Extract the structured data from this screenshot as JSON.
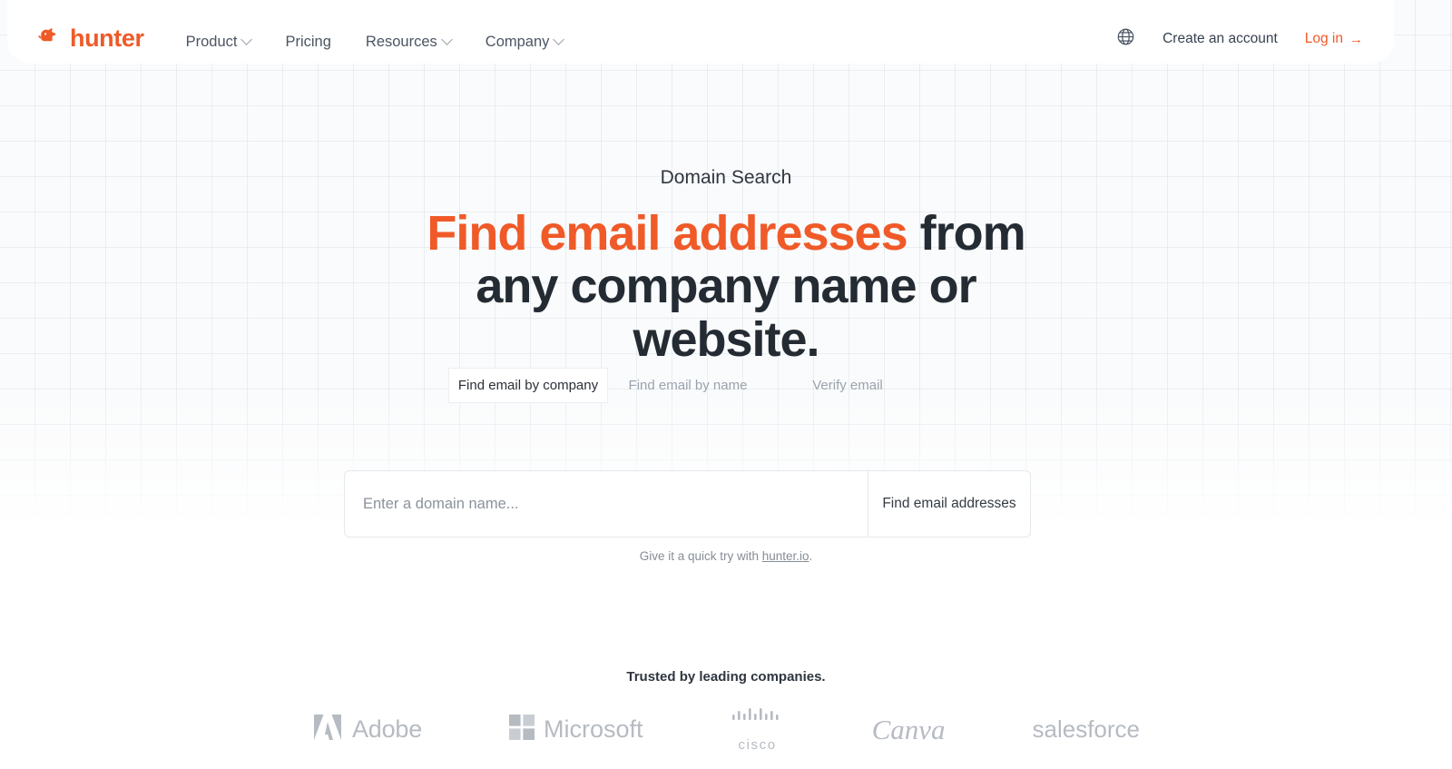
{
  "header": {
    "brand": {
      "name": "hunter",
      "icon": "hunter-dog-logo-icon",
      "color": "#ef5a28"
    },
    "nav_items": [
      {
        "label": "Product",
        "has_dropdown": true
      },
      {
        "label": "Pricing",
        "has_dropdown": false
      },
      {
        "label": "Resources",
        "has_dropdown": true
      },
      {
        "label": "Company",
        "has_dropdown": true
      }
    ],
    "language_icon": "globe-icon",
    "create_account_label": "Create an account",
    "login_label": "Log in",
    "login_arrow": "→"
  },
  "hero": {
    "eyebrow": "Domain Search",
    "headline_accent": "Find email addresses",
    "headline_rest": " from any company name or website."
  },
  "tabs": [
    {
      "label": "Find email by company",
      "active": true
    },
    {
      "label": "Find email by name",
      "active": false
    },
    {
      "label": "Verify email",
      "active": false
    }
  ],
  "search": {
    "placeholder": "Enter a domain name...",
    "value": "",
    "button_label": "Find email addresses"
  },
  "quick_try": {
    "prefix": "Give it a quick try with ",
    "link": "hunter.io",
    "suffix": "."
  },
  "trusted": {
    "label": "Trusted by leading companies.",
    "logos": [
      {
        "name": "Adobe",
        "icon": "adobe-logo-icon"
      },
      {
        "name": "Microsoft",
        "icon": "microsoft-logo-icon"
      },
      {
        "name": "cisco",
        "icon": "cisco-logo-icon"
      },
      {
        "name": "Canva",
        "icon": "canva-logo-icon"
      },
      {
        "name": "salesforce",
        "icon": "salesforce-logo-icon"
      }
    ]
  },
  "colors": {
    "accent": "#ef5a28",
    "text_dark": "#242b33",
    "text_muted": "#868d96",
    "grid_line": "#cbd5e0",
    "page_bg": "#fafbfc"
  }
}
